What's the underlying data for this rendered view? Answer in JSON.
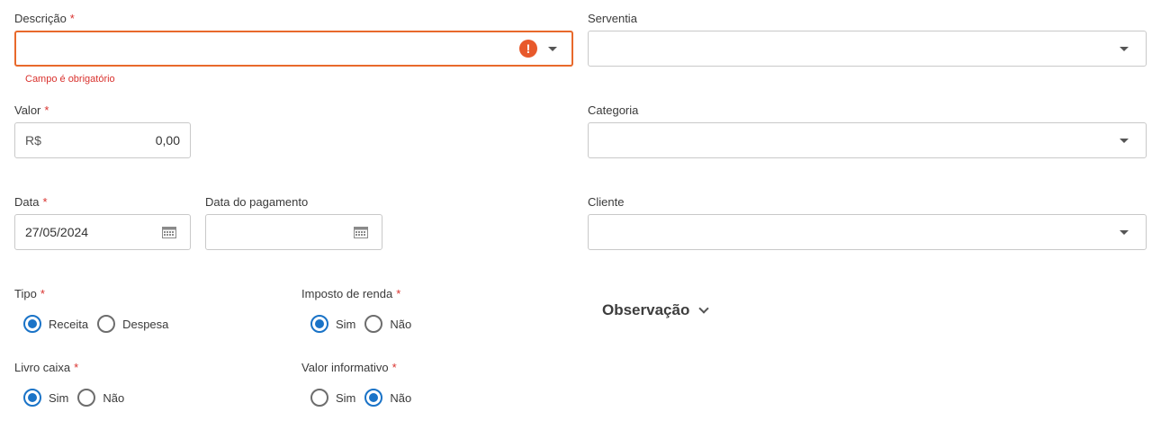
{
  "descricao": {
    "label": "Descrição",
    "required": "*",
    "value": "",
    "error": "!",
    "error_message": "Campo é obrigatório"
  },
  "serventia": {
    "label": "Serventia",
    "value": ""
  },
  "valor": {
    "label": "Valor",
    "required": "*",
    "prefix": "R$",
    "value": "0,00"
  },
  "categoria": {
    "label": "Categoria",
    "value": ""
  },
  "data": {
    "label": "Data",
    "required": "*",
    "value": "27/05/2024"
  },
  "data_pagamento": {
    "label": "Data do pagamento",
    "value": ""
  },
  "cliente": {
    "label": "Cliente",
    "value": ""
  },
  "tipo": {
    "label": "Tipo",
    "required": "*",
    "options": [
      "Receita",
      "Despesa"
    ],
    "selected": "Receita"
  },
  "imposto_renda": {
    "label": "Imposto de renda",
    "required": "*",
    "options": [
      "Sim",
      "Não"
    ],
    "selected": "Sim"
  },
  "livro_caixa": {
    "label": "Livro caixa",
    "required": "*",
    "options": [
      "Sim",
      "Não"
    ],
    "selected": "Sim"
  },
  "valor_informativo": {
    "label": "Valor informativo",
    "required": "*",
    "options": [
      "Sim",
      "Não"
    ],
    "selected": "Não"
  },
  "observacao": {
    "label": "Observação"
  },
  "colors": {
    "accent": "#1a73c7",
    "error": "#e8692b",
    "required": "#d9322e"
  }
}
